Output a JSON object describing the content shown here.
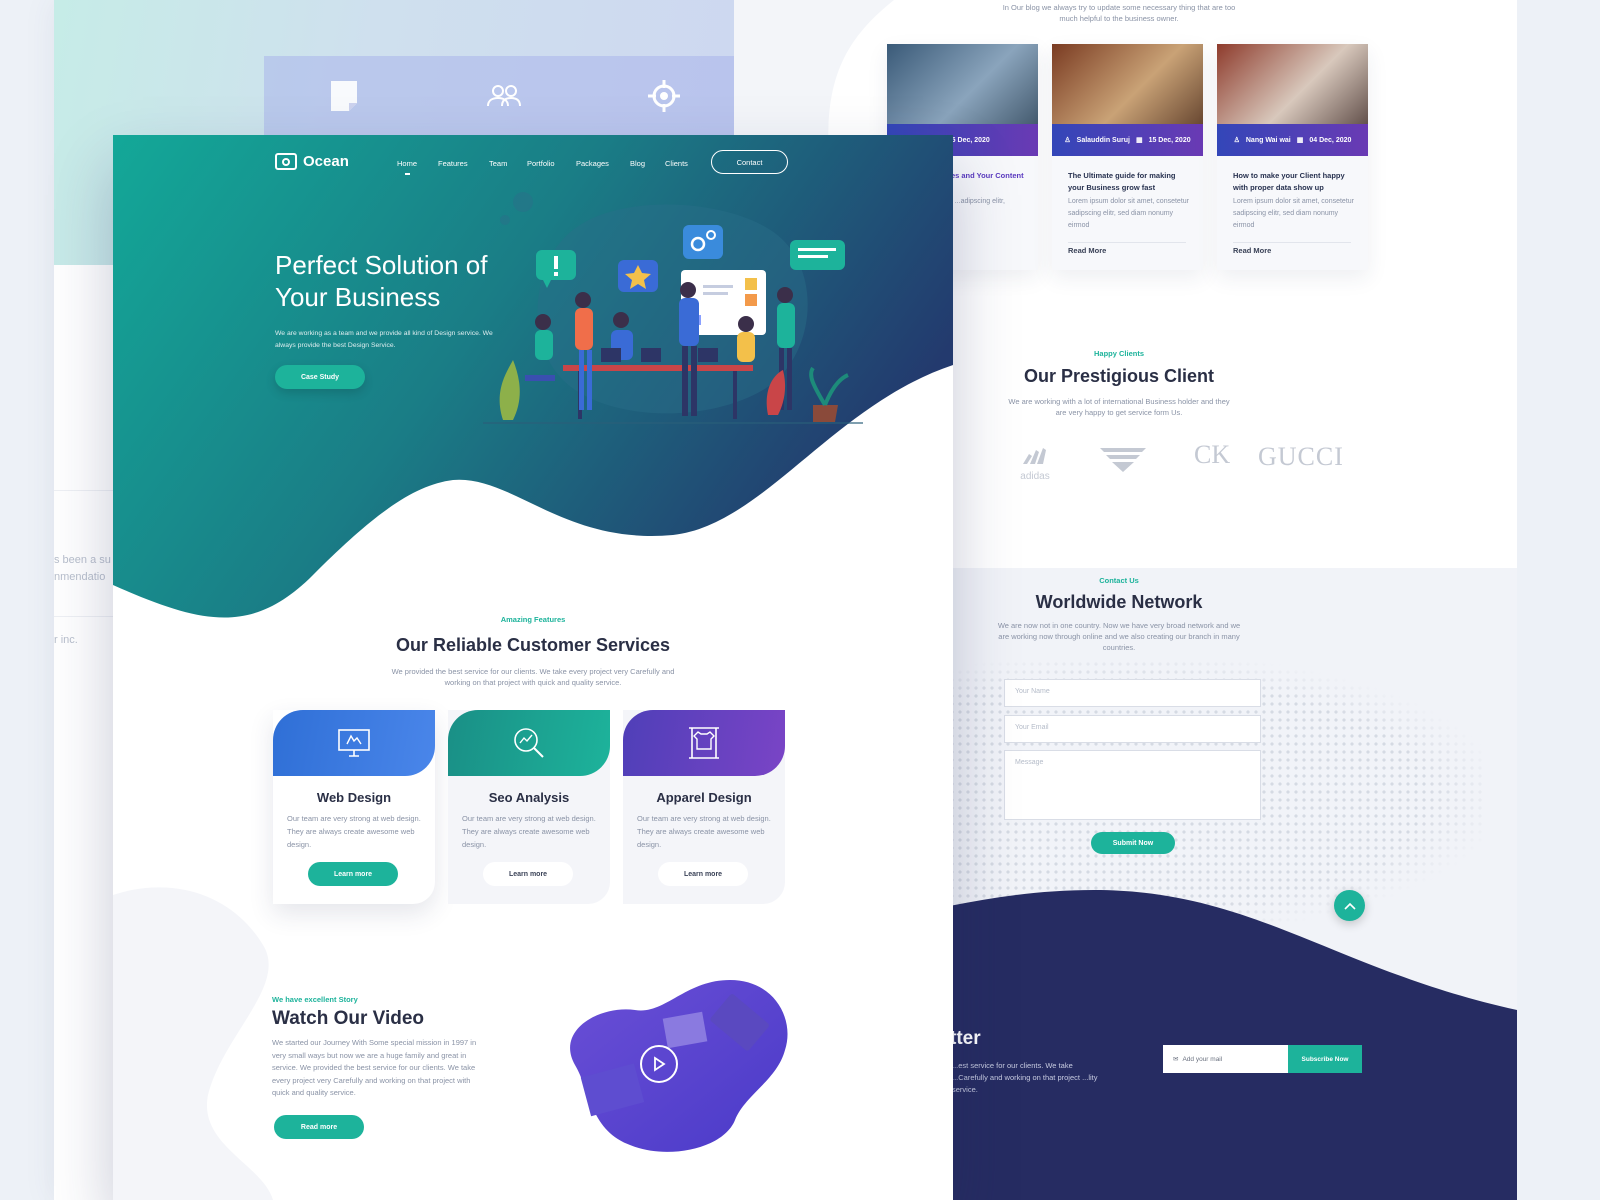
{
  "brand": {
    "name": "Ocean",
    "primary": "#1db39b",
    "navy": "#262c62",
    "purple": "#5b3bc0"
  },
  "nav": {
    "items": [
      "Home",
      "Features",
      "Team",
      "Portfolio",
      "Packages",
      "Blog",
      "Clients"
    ],
    "contact_label": "Contact"
  },
  "hero": {
    "title": "Perfect Solution of Your Business",
    "description": "We are working as a team and we provide all kind of Design service. We always provide the best Design Service.",
    "button_label": "Case Study"
  },
  "services": {
    "small": "Amazing Features",
    "title": "Our Reliable Customer Services",
    "description": "We provided the best service for our clients. We take every project very Carefully and working on that project with quick and quality service.",
    "cards": [
      {
        "name": "Web Design",
        "icon": "monitor-design-icon",
        "description": "Our team are very strong at web design. They are always create awesome web design.",
        "button": "Learn more"
      },
      {
        "name": "Seo Analysis",
        "icon": "magnifier-chart-icon",
        "description": "Our team are very strong at web design. They are always create awesome web design.",
        "button": "Learn more"
      },
      {
        "name": "Apparel Design",
        "icon": "clothes-rack-icon",
        "description": "Our team are very strong at web design. They are always create awesome web design.",
        "button": "Learn more"
      }
    ]
  },
  "story": {
    "small": "We have excellent Story",
    "title": "Watch Our Video",
    "description": "We started our Journey With Some special mission in 1997 in very small ways but now we are a huge family and great in service. We provided the best service for our clients. We take every project very Carefully and working on that project with quick and quality service.",
    "button_label": "Read more"
  },
  "blog": {
    "intro": "In Our blog we always try to update some necessary thing that are too much helpful to the business owner.",
    "posts": [
      {
        "meta_date": "15 Dec, 2020",
        "title": "...se 25 Phrases and Your Content",
        "excerpt": "...dolor sit amet, ...adipscing elitr, ...umy eirmod"
      },
      {
        "author": "Salauddin Suruj",
        "meta_date": "15 Dec, 2020",
        "title": "The Ultimate guide for making your Business grow fast",
        "excerpt": "Lorem ipsum dolor sit amet, consetetur sadipscing elitr, sed diam nonumy eirmod",
        "read_more": "Read More"
      },
      {
        "author": "Nang Wai wai",
        "meta_date": "04 Dec, 2020",
        "title": "How to make your Client happy with proper data show up",
        "excerpt": "Lorem ipsum dolor sit amet, consetetur sadipscing elitr, sed diam nonumy eirmod",
        "read_more": "Read More"
      }
    ]
  },
  "clients": {
    "small": "Happy Clients",
    "title": "Our Prestigious Client",
    "description": "We are working with a lot of international Business holder and they are very happy to get service form Us.",
    "logos": [
      "adidas",
      "Armani",
      "CK",
      "GUCCI"
    ]
  },
  "contact": {
    "small": "Contact Us",
    "title": "Worldwide Network",
    "description": "We are now not in one country. Now we have very broad network and we are working now through online and we also creating our branch in many countries.",
    "name_placeholder": "Your Name",
    "email_placeholder": "Your Email",
    "message_placeholder": "Message",
    "submit_label": "Submit Now"
  },
  "newsletter": {
    "title_fragment": "tter",
    "description": "...est service for our clients. We take ...Carefully and working on that project ...lity service.",
    "input_placeholder": "Add your mail",
    "button_label": "Subscribe Now"
  },
  "back_left": {
    "text_fragments": [
      "s been a su",
      "nmendatio",
      "r inc."
    ]
  }
}
